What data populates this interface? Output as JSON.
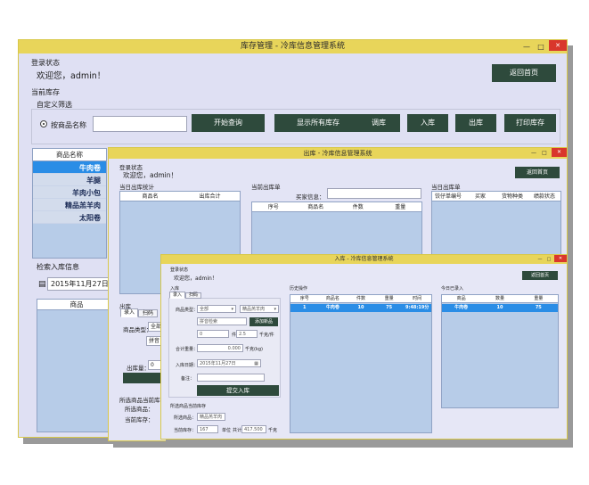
{
  "main": {
    "title": "库存管理 - 冷库信息管理系统",
    "win_controls": {
      "minimize": "—",
      "maximize": "□",
      "close": "✕"
    },
    "login_status_label": "登录状态",
    "welcome": "欢迎您，admin！",
    "back_home": "返回首页",
    "current_stock_label": "当前库存",
    "custom_filter_label": "自定义筛选",
    "by_name_label": "按商品名称",
    "buttons": {
      "query": "开始查询",
      "show_all": "显示所有库存",
      "transfer": "调库",
      "inbound": "入库",
      "outbound": "出库",
      "print": "打印库存"
    },
    "product_list": {
      "header": "商品名称",
      "items": [
        "牛肉卷",
        "羊腿",
        "羊肉小包",
        "精品羔羊肉",
        "太阳卷"
      ]
    },
    "check_inbound_label": "检索入库信息",
    "date_value": "2015年11月27日",
    "goods_header": "商品"
  },
  "outbound": {
    "title": "出库 - 冷库信息管理系统",
    "login_status_label": "登录状态",
    "welcome": "欢迎您，admin！",
    "back_home": "返回首页",
    "today_stats_label": "当日出库统计",
    "today_stats_cols": [
      "商品名",
      "出库合计"
    ],
    "current_orders_label": "当前出库单",
    "buyer_label": "买家信息：",
    "current_cols": [
      "序号",
      "商品名",
      "件数",
      "重量"
    ],
    "today_orders_label": "当日出库单",
    "today_cols": [
      "饺仔单编号",
      "买家",
      "货物种类",
      "绩款状态"
    ],
    "outbound_label": "出库",
    "tabs": [
      "录入",
      "扫码"
    ],
    "goods_type_label": "商品类型：",
    "goods_type_value": "全部",
    "search_hint": "拼音",
    "qty_label": "出库量：",
    "qty_value": "0",
    "selected_stock_label": "所选商品当前库存",
    "selected_goods_label": "所选商品：",
    "current_stock_label": "当前库存："
  },
  "inbound": {
    "title": "入库 - 冷库信息管理系统",
    "login_status_label": "登录状态",
    "welcome": "欢迎您，admin！",
    "back_home": "返回首页",
    "inbound_label": "入库",
    "tabs": [
      "录入",
      "扫码"
    ],
    "goods_type_label": "商品类型：",
    "goods_type_value": "全部",
    "product_select": "精品羔羊肉",
    "search_placeholder": "拼音检索",
    "add_new": "添加新品",
    "pieces_value": "0",
    "pieces_unit": "件",
    "per_value": "2.5",
    "per_unit": "千克/件",
    "total_label": "合计重量：",
    "total_value": "0.000",
    "total_unit": "千克(kg)",
    "date_label": "入库日期：",
    "date_value": "2015年11月27日",
    "note_label": "备注：",
    "submit": "提交入库",
    "selected_stock_label": "所选商品当前库存",
    "selected_goods_label": "所选商品：",
    "selected_goods_value": "精品羔羊肉",
    "current_stock_label": "当前库存：",
    "stock_value": "167",
    "unit_label": "单位",
    "total_short_label": "共计",
    "stock_weight": "417.500",
    "weight_unit": "千克",
    "history_label": "历史操作",
    "history_cols": [
      "序号",
      "商品名",
      "件数",
      "重量",
      "时间"
    ],
    "history_rows": [
      [
        "1",
        "牛肉卷",
        "10",
        "75",
        "9:48:19分"
      ]
    ],
    "today_label": "今日已录入",
    "today_cols": [
      "商品",
      "数量",
      "重量"
    ],
    "today_rows": [
      [
        "牛肉卷",
        "10",
        "75"
      ]
    ]
  },
  "colors": {
    "title_bar": "#e8d55a",
    "dark_button": "#2e4a3c",
    "selected_row": "#2a8de6",
    "panel": "#b7cce8",
    "close": "#d9372c"
  }
}
